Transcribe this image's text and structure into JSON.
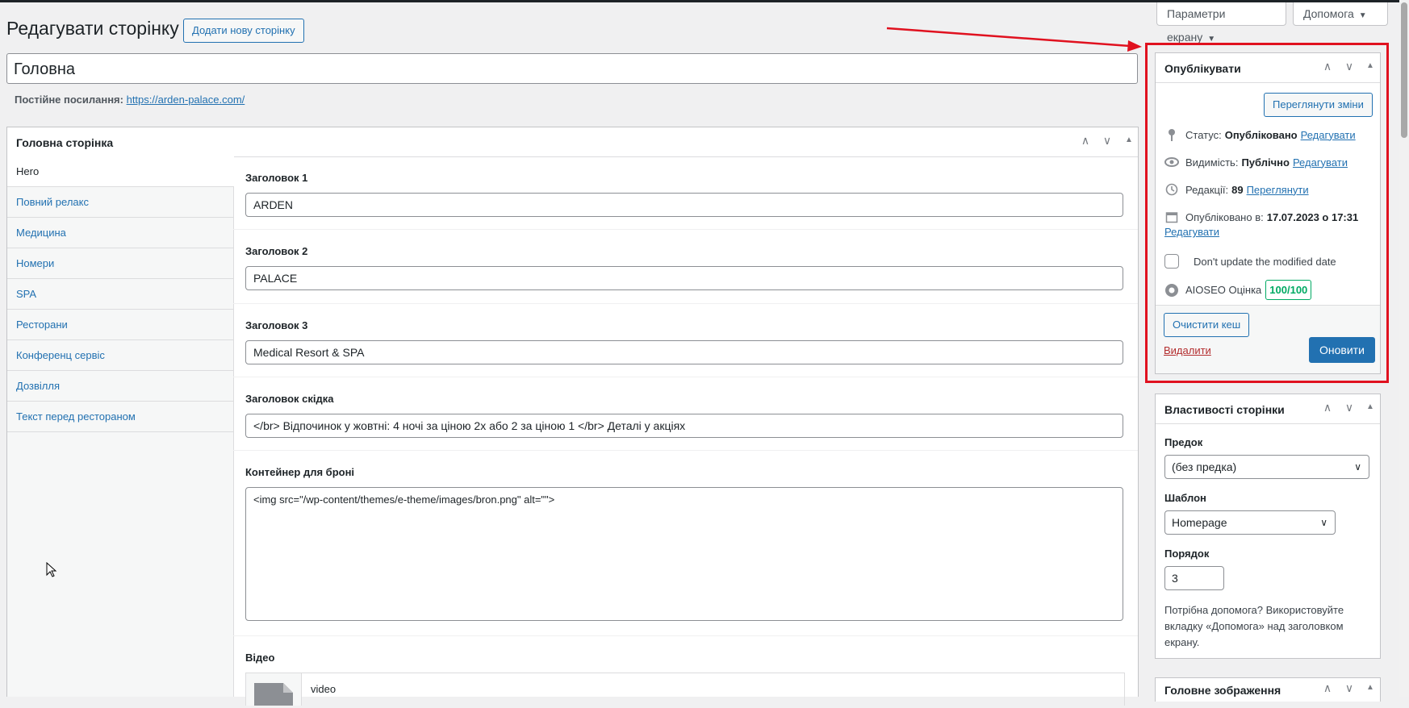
{
  "header": {
    "page_title": "Редагувати сторінку",
    "add_new_button": "Додати нову сторінку",
    "screen_options": "Параметри екрану",
    "help": "Допомога"
  },
  "post": {
    "title": "Головна",
    "permalink_label": "Постійне посилання:",
    "permalink_url": "https://arden-palace.com/"
  },
  "main_box": {
    "title": "Головна сторінка",
    "tabs": [
      {
        "label": "Hero"
      },
      {
        "label": "Повний релакс"
      },
      {
        "label": "Медицина"
      },
      {
        "label": "Номери"
      },
      {
        "label": "SPA"
      },
      {
        "label": "Ресторани"
      },
      {
        "label": "Конференц сервіс"
      },
      {
        "label": "Дозвілля"
      },
      {
        "label": "Текст перед рестораном"
      }
    ],
    "fields": [
      {
        "label": "Заголовок 1",
        "value": "ARDEN"
      },
      {
        "label": "Заголовок 2",
        "value": "PALACE"
      },
      {
        "label": "Заголовок 3",
        "value": "Medical Resort & SPA"
      },
      {
        "label": "Заголовок скідка",
        "value": "</br> Відпочинок у жовтні: 4 ночі за ціною 2х або 2 за ціною 1 </br> Деталі у акціях"
      },
      {
        "label": "Контейнер для броні",
        "value": "<img src=\"/wp-content/themes/e-theme/images/bron.png\" alt=\"\">"
      },
      {
        "label": "Відео",
        "value": "video"
      }
    ]
  },
  "publish": {
    "title": "Опублікувати",
    "preview_button": "Переглянути зміни",
    "status_label": "Статус:",
    "status_value": "Опубліковано",
    "visibility_label": "Видимість:",
    "visibility_value": "Публічно",
    "revisions_label": "Редакції:",
    "revisions_value": "89",
    "published_label": "Опубліковано в:",
    "published_value": "17.07.2023 о 17:31",
    "edit_link": "Редагувати",
    "browse_link": "Переглянути",
    "dont_update_label": "Don't update the modified date",
    "aioseo_label": "AIOSEO Оцінка",
    "aioseo_score": "100/100",
    "clear_cache_button": "Очистити кеш",
    "delete_link": "Видалити",
    "update_button": "Оновити"
  },
  "page_attributes": {
    "title": "Властивості сторінки",
    "parent_label": "Предок",
    "parent_value": "(без предка)",
    "template_label": "Шаблон",
    "template_value": "Homepage",
    "order_label": "Порядок",
    "order_value": "3",
    "help_text": "Потрібна допомога? Використовуйте вкладку «Допомога» над заголовком екрану."
  },
  "featured_image": {
    "title": "Головне зображення"
  },
  "colors": {
    "accent": "#2271b1",
    "highlight_frame": "#e0111f",
    "score_green": "#00aa63"
  }
}
